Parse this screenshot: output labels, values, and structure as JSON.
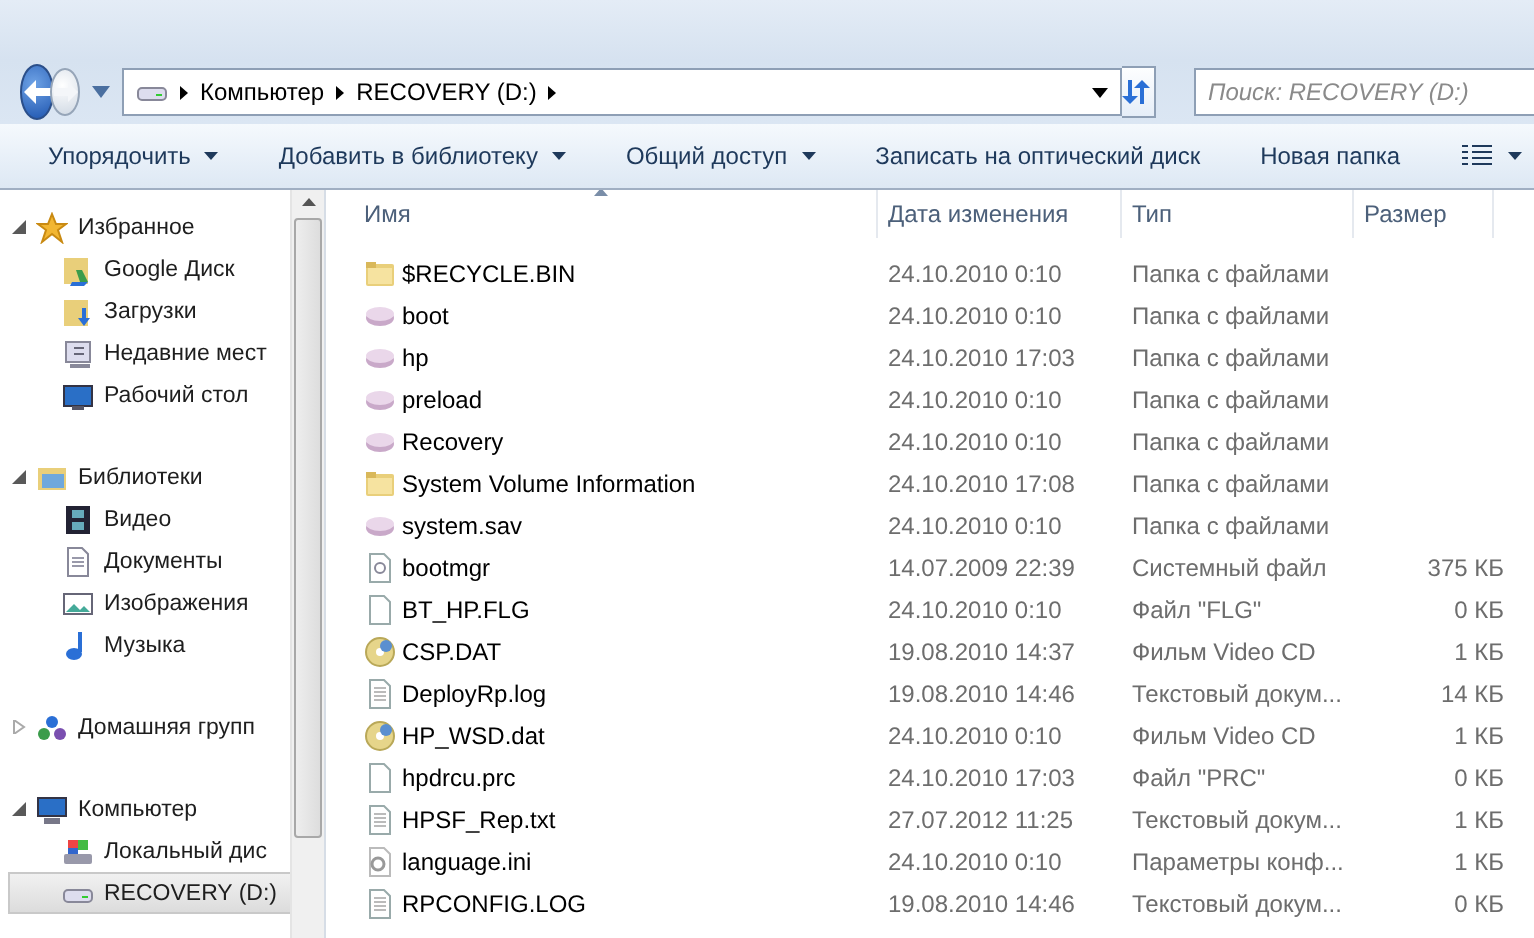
{
  "nav": {
    "breadcrumb": [
      "Компьютер",
      "RECOVERY (D:)"
    ],
    "search": {
      "placeholder": "Поиск: RECOVERY (D:)"
    }
  },
  "toolbar": [
    {
      "label": "Упорядочить",
      "dropdown": true
    },
    {
      "label": "Добавить в библиотеку",
      "dropdown": true
    },
    {
      "label": "Общий доступ",
      "dropdown": true
    },
    {
      "label": "Записать на оптический диск",
      "dropdown": false
    },
    {
      "label": "Новая папка",
      "dropdown": false
    }
  ],
  "sidebar": [
    {
      "label": "Избранное",
      "expanded": true,
      "children": [
        {
          "label": "Google Диск",
          "selected": false
        },
        {
          "label": "Загрузки",
          "selected": false
        },
        {
          "label": "Недавние мест",
          "selected": false
        },
        {
          "label": "Рабочий стол",
          "selected": false
        }
      ]
    },
    {
      "label": "Библиотеки",
      "expanded": true,
      "children": [
        {
          "label": "Видео",
          "selected": false
        },
        {
          "label": "Документы",
          "selected": false
        },
        {
          "label": "Изображения",
          "selected": false
        },
        {
          "label": "Музыка",
          "selected": false
        }
      ]
    },
    {
      "label": "Домашняя групп",
      "expanded": false
    },
    {
      "label": "Компьютер",
      "expanded": true,
      "children": [
        {
          "label": "Локальный дис",
          "selected": false
        },
        {
          "label": "RECOVERY (D:)",
          "selected": true
        }
      ]
    }
  ],
  "columns": [
    "Имя",
    "Дата изменения",
    "Тип",
    "Размер"
  ],
  "rows": [
    {
      "name": "$RECYCLE.BIN",
      "date": "24.10.2010 0:10",
      "type": "Папка с файлами"
    },
    {
      "name": "boot",
      "date": "24.10.2010 0:10",
      "type": "Папка с файлами"
    },
    {
      "name": "hp",
      "date": "24.10.2010 17:03",
      "type": "Папка с файлами"
    },
    {
      "name": "preload",
      "date": "24.10.2010 0:10",
      "type": "Папка с файлами"
    },
    {
      "name": "Recovery",
      "date": "24.10.2010 0:10",
      "type": "Папка с файлами"
    },
    {
      "name": "System Volume Information",
      "date": "24.10.2010 17:08",
      "type": "Папка с файлами"
    },
    {
      "name": "system.sav",
      "date": "24.10.2010 0:10",
      "type": "Папка с файлами"
    },
    {
      "name": "bootmgr",
      "date": "14.07.2009 22:39",
      "type": "Системный файл",
      "size": "375 КБ"
    },
    {
      "name": "BT_HP.FLG",
      "date": "24.10.2010 0:10",
      "type": "Файл \"FLG\"",
      "size": "0 КБ"
    },
    {
      "name": "CSP.DAT",
      "date": "19.08.2010 14:37",
      "type": "Фильм Video CD",
      "size": "1 КБ"
    },
    {
      "name": "DeployRp.log",
      "date": "19.08.2010 14:46",
      "type": "Текстовый докум...",
      "size": "14 КБ"
    },
    {
      "name": "HP_WSD.dat",
      "date": "24.10.2010 0:10",
      "type": "Фильм Video CD",
      "size": "1 КБ"
    },
    {
      "name": "hpdrcu.prc",
      "date": "24.10.2010 17:03",
      "type": "Файл \"PRC\"",
      "size": "0 КБ"
    },
    {
      "name": "HPSF_Rep.txt",
      "date": "27.07.2012 11:25",
      "type": "Текстовый докум...",
      "size": "1 КБ"
    },
    {
      "name": "language.ini",
      "date": "24.10.2010 0:10",
      "type": "Параметры конф...",
      "size": "1 КБ"
    },
    {
      "name": "RPCONFIG.LOG",
      "date": "19.08.2010 14:46",
      "type": "Текстовый докум...",
      "size": "0 КБ"
    }
  ]
}
